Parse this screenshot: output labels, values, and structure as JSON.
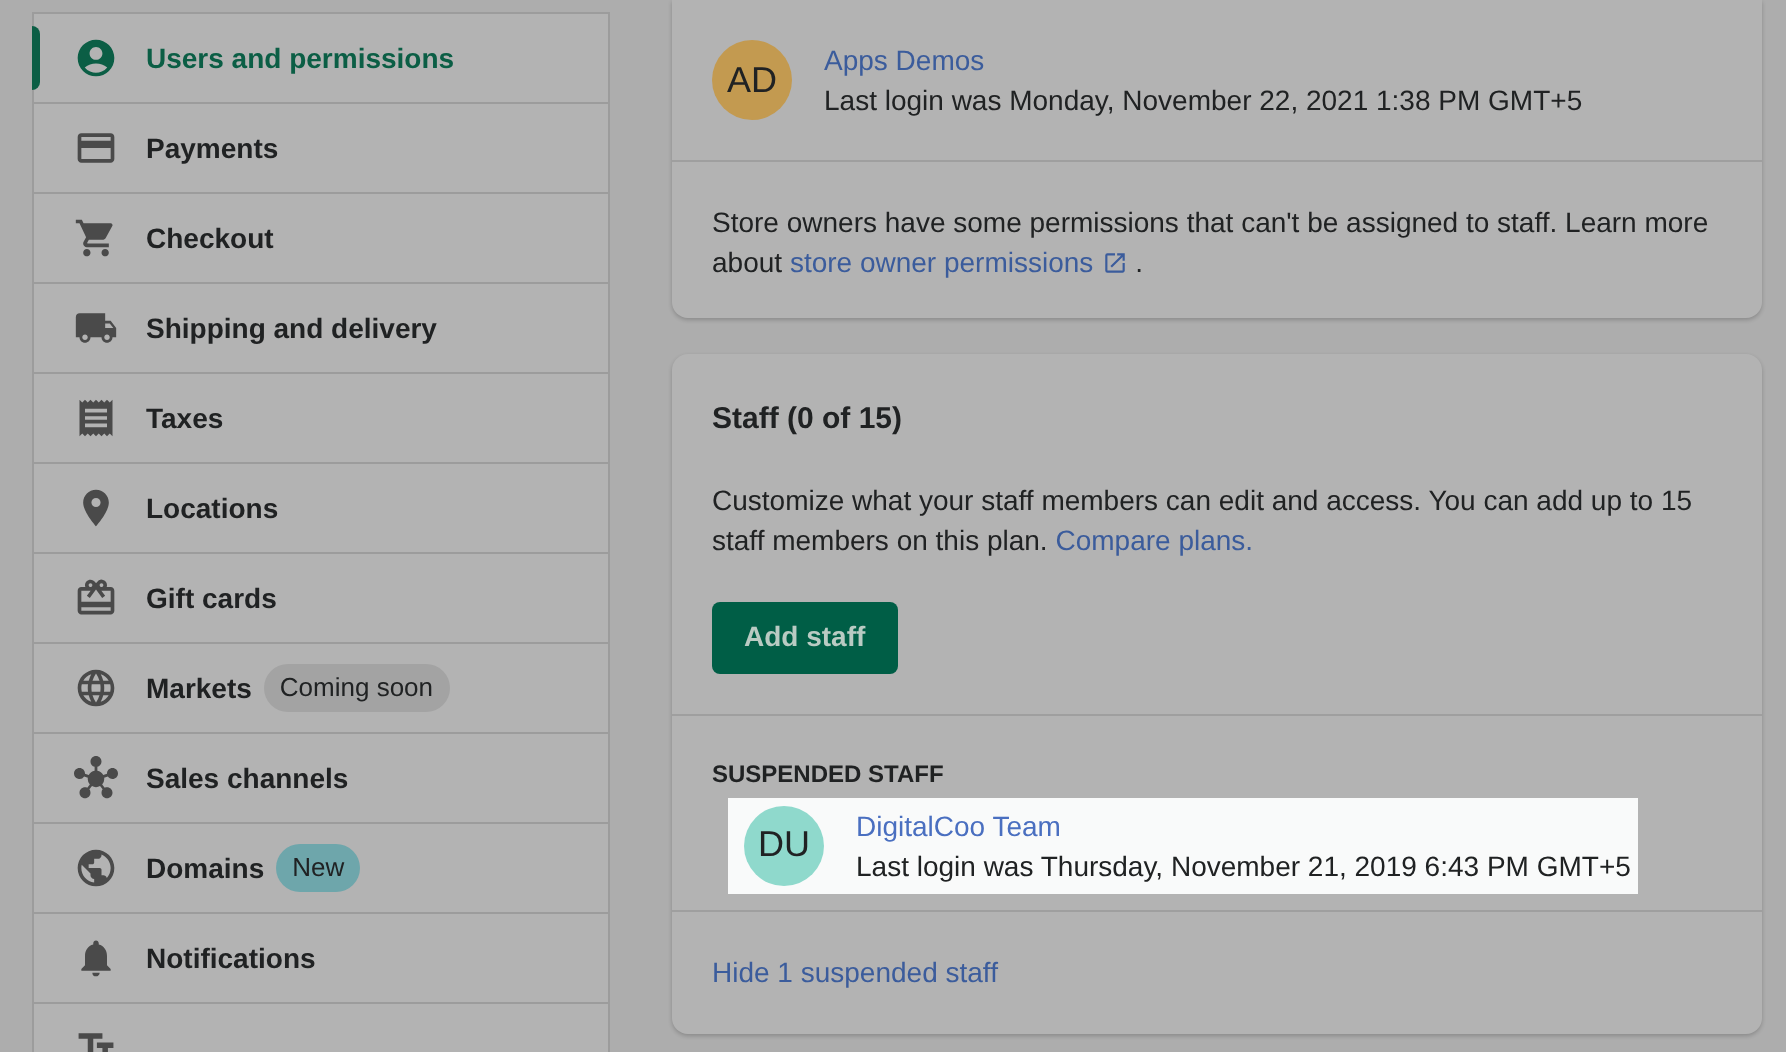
{
  "sidebar": {
    "items": [
      {
        "label": "Users and permissions",
        "selected": true
      },
      {
        "label": "Payments",
        "selected": false
      },
      {
        "label": "Checkout",
        "selected": false
      },
      {
        "label": "Shipping and delivery",
        "selected": false
      },
      {
        "label": "Taxes",
        "selected": false
      },
      {
        "label": "Locations",
        "selected": false
      },
      {
        "label": "Gift cards",
        "selected": false
      },
      {
        "label": "Markets",
        "selected": false,
        "badge": {
          "text": "Coming soon",
          "color": "#a3a3a3"
        }
      },
      {
        "label": "Sales channels",
        "selected": false
      },
      {
        "label": "Domains",
        "selected": false,
        "badge": {
          "text": "New",
          "color": "#6ea6ab"
        }
      },
      {
        "label": "Notifications",
        "selected": false
      },
      {
        "selected": false
      }
    ]
  },
  "owner_card": {
    "owner": {
      "initials": "AD",
      "color": "#c39a50",
      "name": "Apps Demos",
      "last_login": "Last login was Monday, November 22, 2021 1:38 PM GMT+5"
    },
    "note": "Store owners have some permissions that can't be assigned to staff. Learn more about",
    "note_link": "store owner permissions",
    "note_end": "."
  },
  "staff_card": {
    "title": "Staff (0 of 15)",
    "description": "Customize what your staff members can edit and access. You can add up to 15 staff members on this plan.",
    "description_link": "Compare plans.",
    "add_button": "Add staff",
    "suspended_heading": "SUSPENDED STAFF",
    "suspended": [
      {
        "initials": "DU",
        "color": "#8fd9cc",
        "name": "DigitalCoo Team",
        "last_login": "Last login was Thursday, November 21, 2019 6:43 PM GMT+5",
        "highlighted": true
      }
    ],
    "hide_link": "Hide 1 suspended staff"
  }
}
